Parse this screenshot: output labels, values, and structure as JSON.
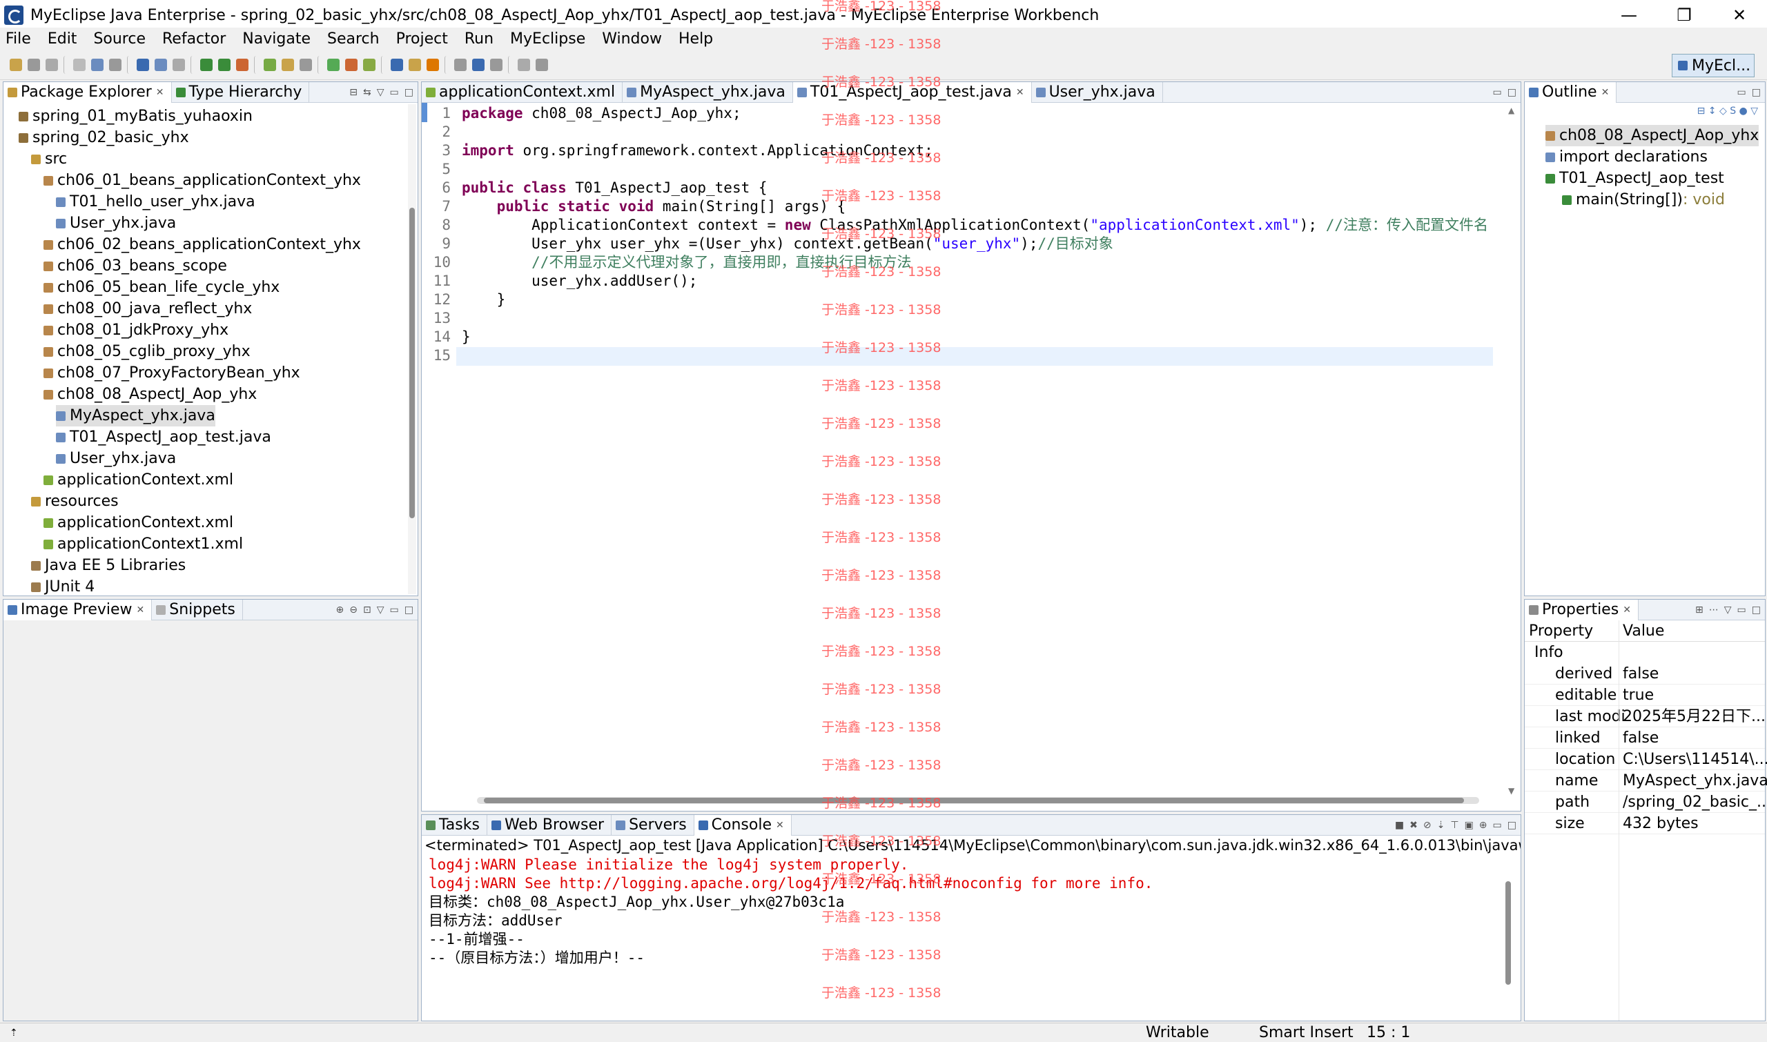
{
  "window": {
    "title": "MyEclipse Java Enterprise - spring_02_basic_yhx/src/ch08_08_AspectJ_Aop_yhx/T01_AspectJ_aop_test.java - MyEclipse Enterprise Workbench",
    "minimize": "—",
    "restore": "❐",
    "close": "✕"
  },
  "menu": [
    "File",
    "Edit",
    "Source",
    "Refactor",
    "Navigate",
    "Search",
    "Project",
    "Run",
    "MyEclipse",
    "Window",
    "Help"
  ],
  "perspective": "MyEcl...",
  "package_explorer": {
    "tabs": [
      "Package Explorer",
      "Type Hierarchy"
    ],
    "items": [
      {
        "label": "spring_01_myBatis_yuhaoxin",
        "indent": 0,
        "color": "#8d6e3a"
      },
      {
        "label": "spring_02_basic_yhx",
        "indent": 0,
        "color": "#8d6e3a"
      },
      {
        "label": "src",
        "indent": 1,
        "color": "#c49a3c"
      },
      {
        "label": "ch06_01_beans_applicationContext_yhx",
        "indent": 2,
        "color": "#b8864b"
      },
      {
        "label": "T01_hello_user_yhx.java",
        "indent": 3,
        "color": "#6b8cbf"
      },
      {
        "label": "User_yhx.java",
        "indent": 3,
        "color": "#6b8cbf"
      },
      {
        "label": "ch06_02_beans_applicationContext_yhx",
        "indent": 2,
        "color": "#b8864b"
      },
      {
        "label": "ch06_03_beans_scope",
        "indent": 2,
        "color": "#b8864b"
      },
      {
        "label": "ch06_05_bean_life_cycle_yhx",
        "indent": 2,
        "color": "#b8864b"
      },
      {
        "label": "ch08_00_java_reflect_yhx",
        "indent": 2,
        "color": "#b8864b"
      },
      {
        "label": "ch08_01_jdkProxy_yhx",
        "indent": 2,
        "color": "#b8864b"
      },
      {
        "label": "ch08_05_cglib_proxy_yhx",
        "indent": 2,
        "color": "#b8864b"
      },
      {
        "label": "ch08_07_ProxyFactoryBean_yhx",
        "indent": 2,
        "color": "#b8864b"
      },
      {
        "label": "ch08_08_AspectJ_Aop_yhx",
        "indent": 2,
        "color": "#b8864b"
      },
      {
        "label": "MyAspect_yhx.java",
        "indent": 3,
        "color": "#6b8cbf",
        "selected": true
      },
      {
        "label": "T01_AspectJ_aop_test.java",
        "indent": 3,
        "color": "#6b8cbf"
      },
      {
        "label": "User_yhx.java",
        "indent": 3,
        "color": "#6b8cbf"
      },
      {
        "label": "applicationContext.xml",
        "indent": 2,
        "color": "#7fae3b"
      },
      {
        "label": "resources",
        "indent": 1,
        "color": "#c49a3c"
      },
      {
        "label": "applicationContext.xml",
        "indent": 2,
        "color": "#7fae3b"
      },
      {
        "label": "applicationContext1.xml",
        "indent": 2,
        "color": "#7fae3b"
      },
      {
        "label": "Java EE 5 Libraries",
        "indent": 1,
        "color": "#9c7b4e"
      },
      {
        "label": "JUnit 4",
        "indent": 1,
        "color": "#9c7b4e"
      }
    ]
  },
  "image_preview": {
    "tabs": [
      "Image Preview",
      "Snippets"
    ]
  },
  "editor": {
    "tabs": [
      "applicationContext.xml",
      "MyAspect_yhx.java",
      "T01_AspectJ_aop_test.java",
      "User_yhx.java"
    ],
    "active_tab": 2,
    "lines": [
      {
        "n": "1",
        "segs": [
          [
            "kw",
            "package"
          ],
          [
            "",
            "ch08_08_AspectJ_Aop_yhx;"
          ]
        ]
      },
      {
        "n": "2",
        "segs": []
      },
      {
        "n": "3",
        "segs": [
          [
            "kw",
            "import"
          ],
          [
            "",
            "org.springframework.context.ApplicationContext;"
          ]
        ]
      },
      {
        "n": "5",
        "segs": []
      },
      {
        "n": "6",
        "segs": [
          [
            "kw",
            "public class"
          ],
          [
            "",
            "T01_AspectJ_aop_test {"
          ]
        ]
      },
      {
        "n": "7",
        "segs": [
          [
            "",
            "    "
          ],
          [
            "kw",
            "public static void"
          ],
          [
            "",
            "main(String[] args) {"
          ]
        ]
      },
      {
        "n": "8",
        "segs": [
          [
            "",
            "        ApplicationContext context = "
          ],
          [
            "kw",
            "new"
          ],
          [
            "",
            "ClassPathXmlApplicationContext("
          ],
          [
            "str",
            "\"applicationContext.xml\""
          ],
          [
            "",
            "); "
          ],
          [
            "cm",
            "//注意：传入配置文件名"
          ]
        ]
      },
      {
        "n": "9",
        "segs": [
          [
            "",
            "        User_yhx user_yhx =(User_yhx) context.getBean("
          ],
          [
            "str",
            "\"user_yhx\""
          ],
          [
            "",
            ");"
          ],
          [
            "cm",
            "//目标对象"
          ]
        ]
      },
      {
        "n": "10",
        "segs": [
          [
            "",
            "        "
          ],
          [
            "cm",
            "//不用显示定义代理对象了，直接用即，直接执行目标方法"
          ]
        ]
      },
      {
        "n": "11",
        "segs": [
          [
            "",
            "        user_yhx.addUser();"
          ]
        ]
      },
      {
        "n": "12",
        "segs": [
          [
            "",
            "    }"
          ]
        ]
      },
      {
        "n": "13",
        "segs": []
      },
      {
        "n": "14",
        "segs": [
          [
            "",
            "}"
          ]
        ]
      },
      {
        "n": "15",
        "segs": []
      }
    ]
  },
  "outline": {
    "tab": "Outline",
    "items": [
      {
        "label": "ch08_08_AspectJ_Aop_yhx",
        "indent": 0,
        "color": "#b8864b",
        "selected": true
      },
      {
        "label": "import declarations",
        "indent": 0,
        "color": "#6b8cbf"
      },
      {
        "label": "T01_AspectJ_aop_test",
        "indent": 0,
        "color": "#3a8c3a"
      },
      {
        "label": "main(String[])",
        "suffix": " : void",
        "indent": 1,
        "color": "#3a8c3a"
      }
    ]
  },
  "properties": {
    "tab": "Properties",
    "header": [
      "Property",
      "Value"
    ],
    "group": "Info",
    "rows": [
      [
        "derived",
        "false"
      ],
      [
        "editable",
        "true"
      ],
      [
        "last modi",
        "2025年5月22日下..."
      ],
      [
        "linked",
        "false"
      ],
      [
        "location",
        "C:\\Users\\114514\\..."
      ],
      [
        "name",
        "MyAspect_yhx.java"
      ],
      [
        "path",
        "/spring_02_basic_..."
      ],
      [
        "size",
        "432  bytes"
      ]
    ]
  },
  "console": {
    "tabs": [
      "Tasks",
      "Web Browser",
      "Servers",
      "Console"
    ],
    "header": "<terminated> T01_AspectJ_aop_test [Java Application] C:\\Users\\114514\\MyEclipse\\Common\\binary\\com.sun.java.jdk.win32.x86_64_1.6.0.013\\bin\\javaw.exe (2",
    "lines": [
      {
        "text": "log4j:WARN Please initialize the log4j system properly.",
        "color": "#e00000"
      },
      {
        "text": "log4j:WARN See http://logging.apache.org/log4j/1.2/faq.html#noconfig for more info.",
        "color": "#e00000"
      },
      {
        "text": "目标类：ch08_08_AspectJ_Aop_yhx.User_yhx@27b03c1a",
        "color": "#000000"
      },
      {
        "text": "目标方法：addUser",
        "color": "#000000"
      },
      {
        "text": "--1-前增强--",
        "color": "#000000"
      },
      {
        "text": "--（原目标方法：）增加用户！--",
        "color": "#000000"
      }
    ]
  },
  "statusbar": {
    "writable": "Writable",
    "insert": "Smart Insert",
    "position": "15 : 1"
  },
  "watermark": "于浩鑫 -123 - 1358"
}
